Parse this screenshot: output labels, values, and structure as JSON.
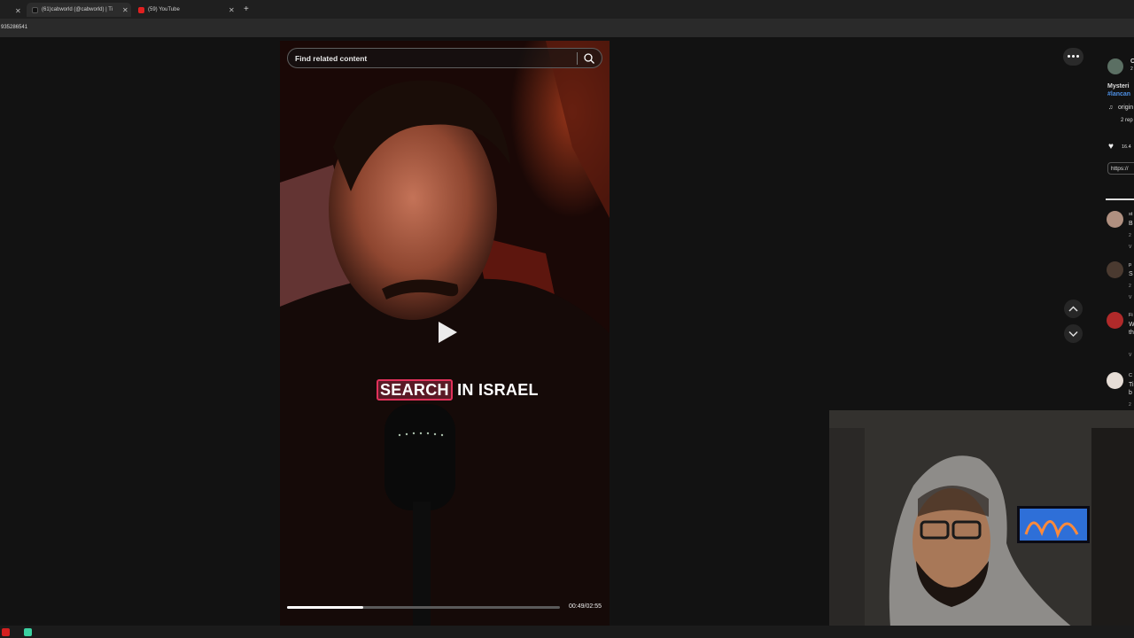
{
  "browser": {
    "tabs": [
      {
        "label": "(61)cabworld (@cabworld) | Ti"
      },
      {
        "label": "(59) YouTube"
      }
    ],
    "new_tab_icon": "plus-icon",
    "url": "935286541"
  },
  "video": {
    "search_placeholder": "Find related content",
    "caption_highlight": "SEARCH",
    "caption_rest": " IN ISRAEL",
    "time": "00:49/02:55",
    "progress": 0.28
  },
  "sidebar": {
    "author_initial": "C",
    "author_sub": "2",
    "desc_line1": "Mysteri",
    "desc_tag": "#lancan",
    "sound": "origin",
    "replies": "2 rep",
    "likes": "16.4",
    "link": "https://",
    "comments": [
      {
        "name": "st",
        "text": "B",
        "meta": "2",
        "view": "V"
      },
      {
        "name": "p",
        "text": "S",
        "meta": "2",
        "view": "V"
      },
      {
        "name": "Fi",
        "text": "W",
        "text2": "th",
        "view": "V"
      },
      {
        "name": "C",
        "text": "Ti",
        "text2": "b",
        "meta": "2"
      }
    ]
  },
  "colors": {
    "accent_pink": "#e0315a",
    "link_blue": "#4d8fe3"
  }
}
